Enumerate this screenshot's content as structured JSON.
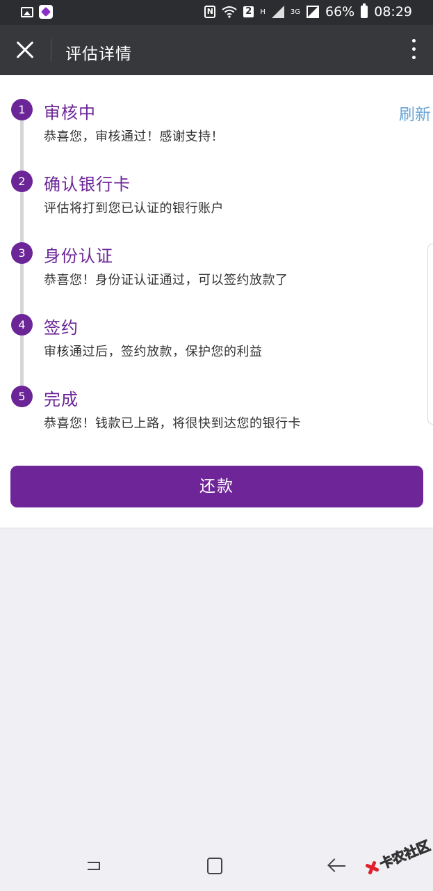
{
  "status_bar": {
    "battery": "66%",
    "time": "08:29",
    "sim_slot": "2",
    "net_h": "H",
    "net_3g": "3G",
    "nfc": "N"
  },
  "header": {
    "title": "评估详情"
  },
  "refresh_label": "刷新",
  "steps": [
    {
      "num": "1",
      "title": "审核中",
      "desc": "恭喜您，审核通过！感谢支持！"
    },
    {
      "num": "2",
      "title": "确认银行卡",
      "desc": "评估将打到您已认证的银行账户"
    },
    {
      "num": "3",
      "title": "身份认证",
      "desc": "恭喜您！身份证认证通过，可以签约放款了"
    },
    {
      "num": "4",
      "title": "签约",
      "desc": "审核通过后，签约放款，保护您的利益"
    },
    {
      "num": "5",
      "title": "完成",
      "desc": "恭喜您！钱款已上路，将很快到达您的银行卡"
    }
  ],
  "repay_button": "还款",
  "watermark": "卡农社区",
  "colors": {
    "accent": "#6e2598",
    "link": "#6aa6d6",
    "header_bg": "#37383c",
    "statusbar_bg": "#2c2d30"
  }
}
